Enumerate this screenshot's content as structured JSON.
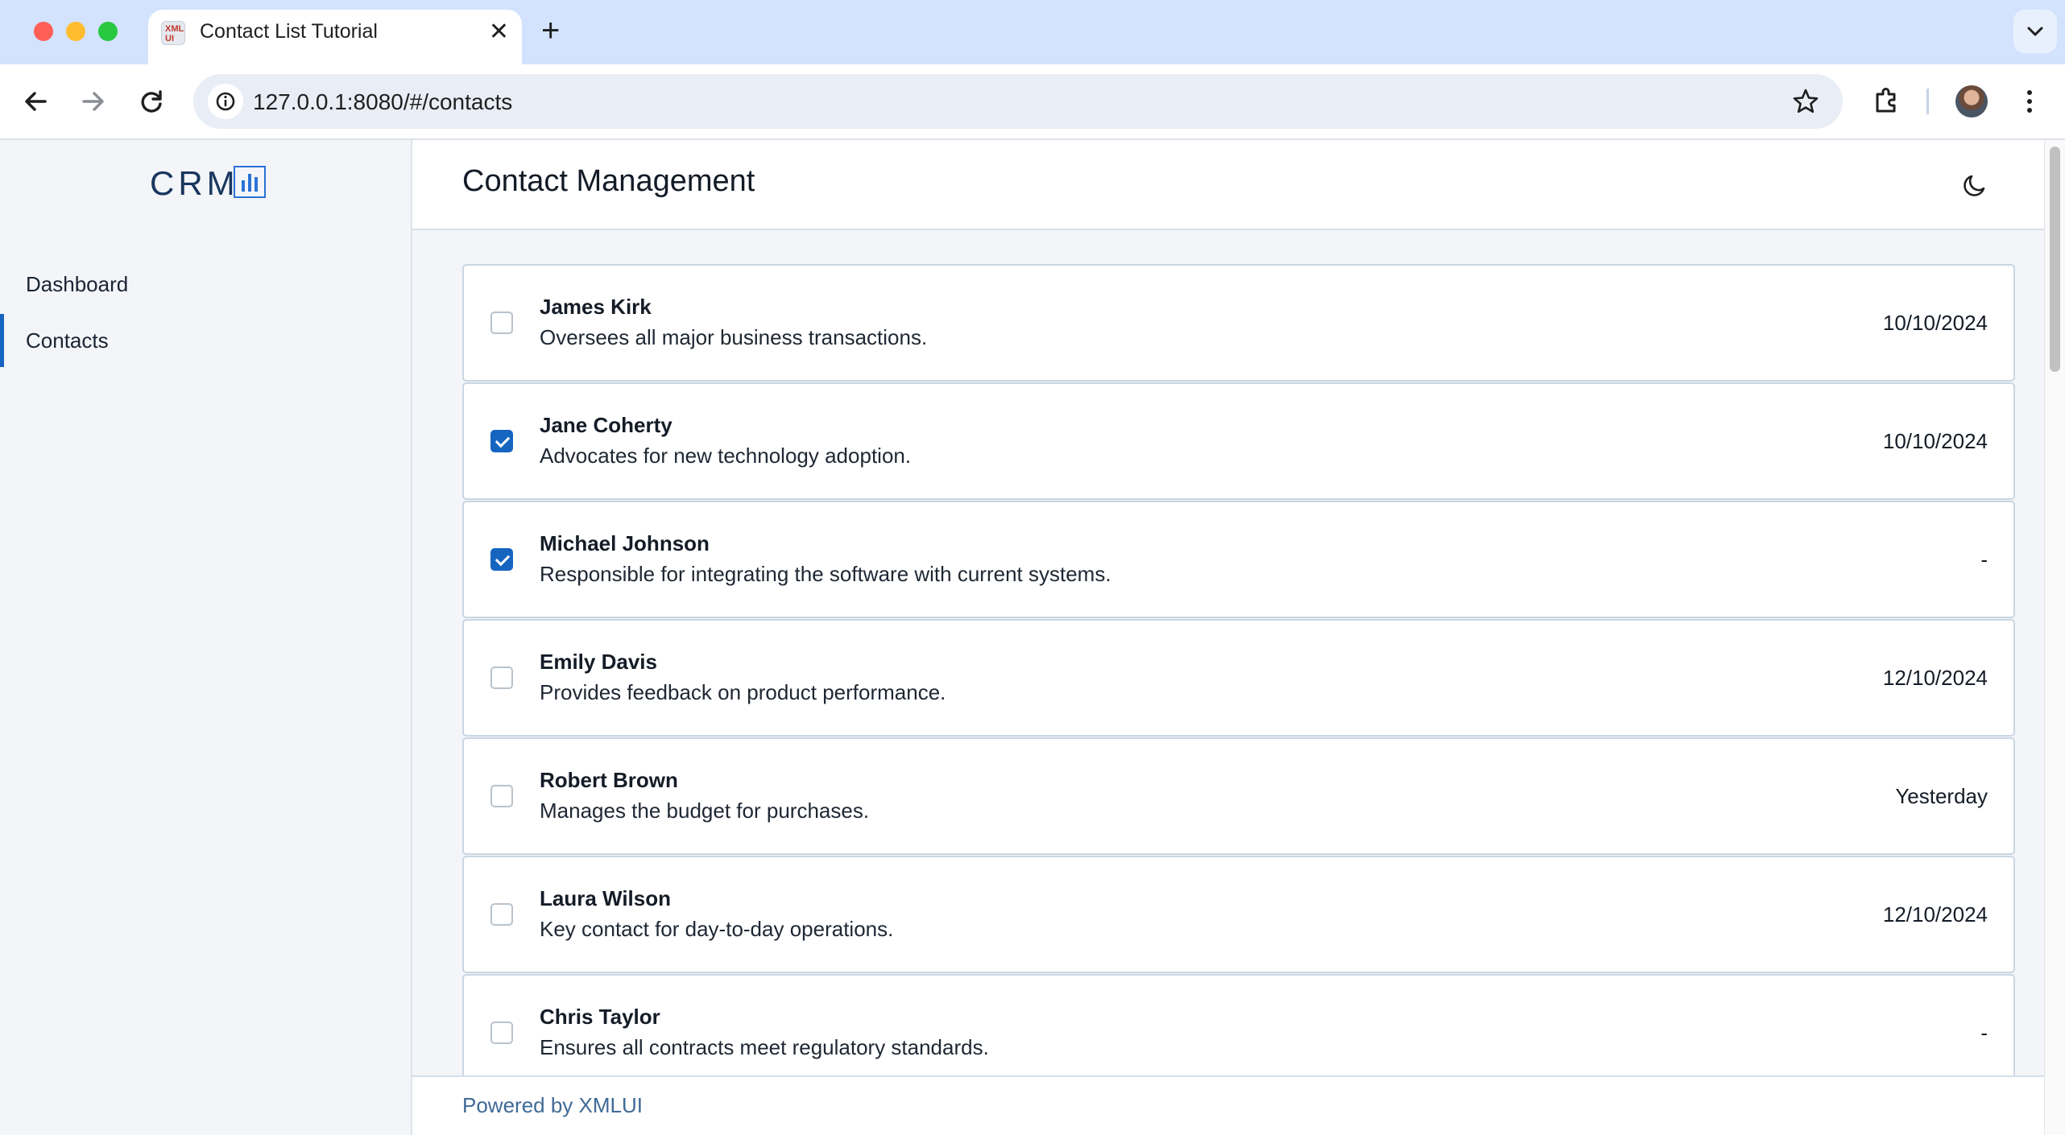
{
  "browser": {
    "tab_title": "Contact List Tutorial",
    "favicon_text_top": "XML",
    "favicon_text_bottom": "UI",
    "url": "127.0.0.1:8080/#/contacts"
  },
  "sidebar": {
    "logo_text": "CRM",
    "items": [
      {
        "label": "Dashboard",
        "active": false
      },
      {
        "label": "Contacts",
        "active": true
      }
    ]
  },
  "header": {
    "title": "Contact Management",
    "theme_toggle_icon": "moon-icon"
  },
  "contacts": [
    {
      "name": "James Kirk",
      "description": "Oversees all major business transactions.",
      "date": "10/10/2024",
      "checked": false
    },
    {
      "name": "Jane Coherty",
      "description": "Advocates for new technology adoption.",
      "date": "10/10/2024",
      "checked": true
    },
    {
      "name": "Michael Johnson",
      "description": "Responsible for integrating the software with current systems.",
      "date": "-",
      "checked": true
    },
    {
      "name": "Emily Davis",
      "description": "Provides feedback on product performance.",
      "date": "12/10/2024",
      "checked": false
    },
    {
      "name": "Robert Brown",
      "description": "Manages the budget for purchases.",
      "date": "Yesterday",
      "checked": false
    },
    {
      "name": "Laura Wilson",
      "description": "Key contact for day-to-day operations.",
      "date": "12/10/2024",
      "checked": false
    },
    {
      "name": "Chris Taylor",
      "description": "Ensures all contracts meet regulatory standards.",
      "date": "-",
      "checked": false
    }
  ],
  "footer": {
    "text": "Powered by XMLUI"
  },
  "colors": {
    "accent": "#1565c0",
    "sidebar_bg": "#f3f5f8",
    "tabstrip_bg": "#d3e3fd"
  }
}
